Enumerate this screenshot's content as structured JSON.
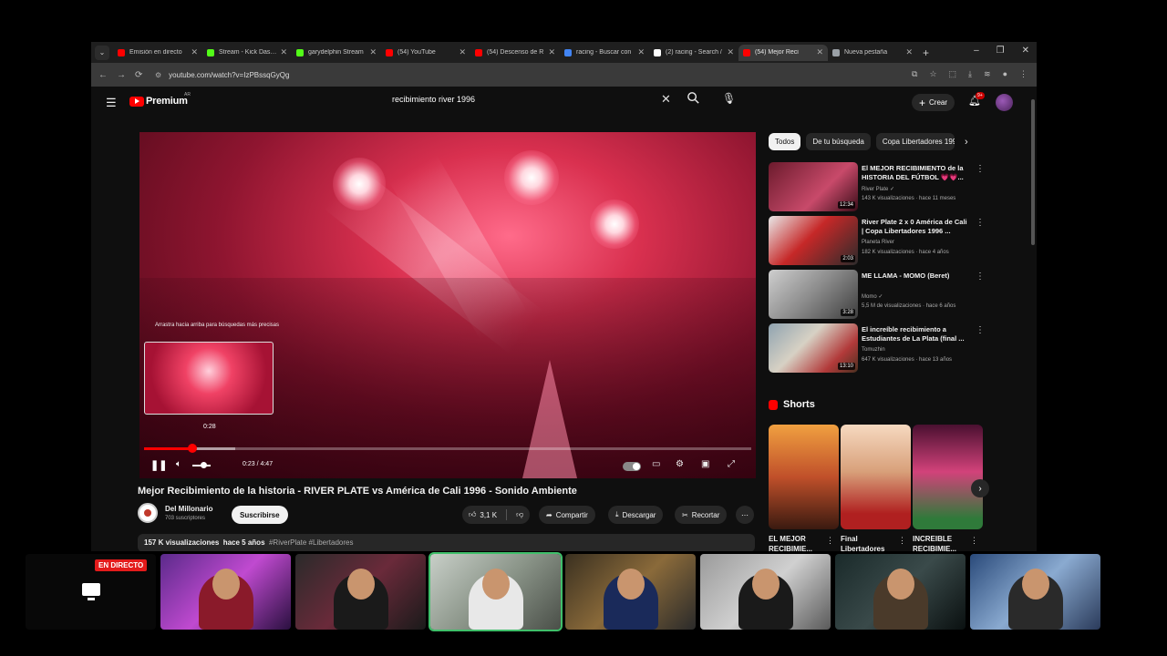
{
  "browser": {
    "tabs": [
      {
        "title": "Emisión en directo",
        "color": "#ff0000"
      },
      {
        "title": "Stream - Kick Dashb",
        "color": "#53fc18"
      },
      {
        "title": "garydelphin Stream",
        "color": "#53fc18"
      },
      {
        "title": "(54) YouTube",
        "color": "#ff0000"
      },
      {
        "title": "(54) Descenso de R",
        "color": "#ff0000"
      },
      {
        "title": "racing - Buscar con",
        "color": "#4285f4"
      },
      {
        "title": "(2) racing - Search /",
        "color": "#ffffff"
      },
      {
        "title": "(54) Mejor Reci",
        "color": "#ff0000",
        "active": true
      },
      {
        "title": "Nueva pestaña",
        "color": "#9aa0a6"
      }
    ],
    "url": "youtube.com/watch?v=IzPBssqGyQg"
  },
  "header": {
    "logo": "Premium",
    "logo_region": "AR",
    "search_query": "recibimiento river 1996",
    "create_label": "Crear",
    "notifications": "9+"
  },
  "player": {
    "hint": "Arrastra hacia arriba para búsquedas más precisas",
    "preview_time": "0:28",
    "time": "0:23 / 4:47",
    "progress_fraction": 0.08
  },
  "video": {
    "title": "Mejor Recibimiento de la historia - RIVER PLATE vs América de Cali 1996 - Sonido Ambiente",
    "channel": "Del Millonario",
    "subscribers": "703 suscriptores",
    "subscribe_label": "Suscribirse",
    "likes": "3,1 K",
    "share_label": "Compartir",
    "download_label": "Descargar",
    "clip_label": "Recortar",
    "views": "157 K visualizaciones",
    "age": "hace 5 años",
    "tags": "#RiverPlate #Libertadores"
  },
  "sidebar": {
    "chips": [
      "Todos",
      "De tu búsqueda",
      "Copa Libertadores 1996"
    ],
    "recommendations": [
      {
        "title": "El MEJOR RECIBIMIENTO de la HISTORIA DEL FÚTBOL 💗💗...",
        "channel": "River Plate ✓",
        "meta": "143 K visualizaciones · hace 11 meses",
        "duration": "12:34"
      },
      {
        "title": "River Plate 2 x 0 América de Cali | Copa Libertadores 1996 ...",
        "channel": "Planeta River",
        "meta": "182 K visualizaciones · hace 4 años",
        "duration": "2:03"
      },
      {
        "title": "ME LLAMA - MOMO (Beret)",
        "channel": "Momo ✓",
        "meta": "5,5 M de visualizaciones · hace 6 años",
        "duration": "3:28"
      },
      {
        "title": "El increíble recibimiento a Estudiantes de La Plata (final ...",
        "channel": "Tomuzhin",
        "meta": "647 K visualizaciones · hace 13 años",
        "duration": "13:10"
      }
    ],
    "shorts_title": "Shorts",
    "shorts": [
      {
        "title": "EL MEJOR RECIBIMIE..."
      },
      {
        "title": "Final Libertadores"
      },
      {
        "title": "INCREIBLE RECIBIMIE..."
      }
    ]
  },
  "stream": {
    "live_label": "EN DIRECTO"
  }
}
